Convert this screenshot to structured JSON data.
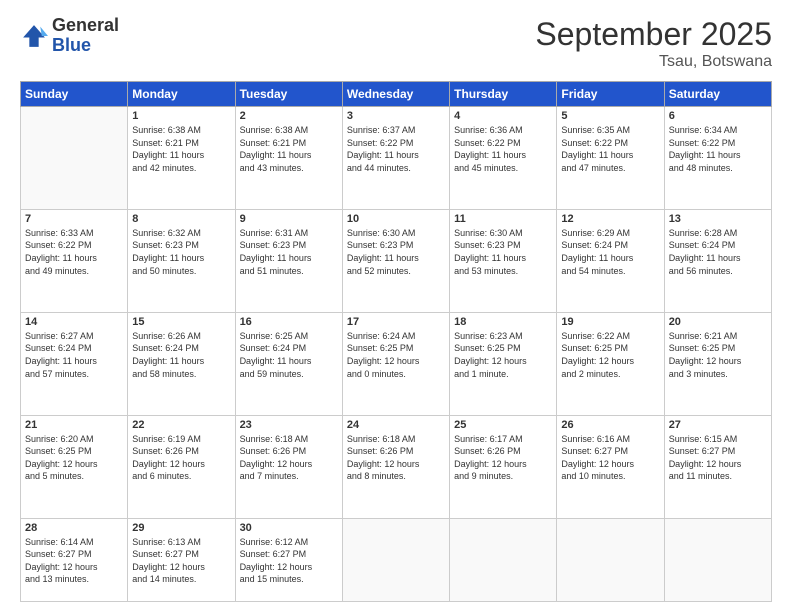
{
  "logo": {
    "general": "General",
    "blue": "Blue"
  },
  "header": {
    "month": "September 2025",
    "location": "Tsau, Botswana"
  },
  "weekdays": [
    "Sunday",
    "Monday",
    "Tuesday",
    "Wednesday",
    "Thursday",
    "Friday",
    "Saturday"
  ],
  "weeks": [
    [
      {
        "day": "",
        "info": ""
      },
      {
        "day": "1",
        "info": "Sunrise: 6:38 AM\nSunset: 6:21 PM\nDaylight: 11 hours\nand 42 minutes."
      },
      {
        "day": "2",
        "info": "Sunrise: 6:38 AM\nSunset: 6:21 PM\nDaylight: 11 hours\nand 43 minutes."
      },
      {
        "day": "3",
        "info": "Sunrise: 6:37 AM\nSunset: 6:22 PM\nDaylight: 11 hours\nand 44 minutes."
      },
      {
        "day": "4",
        "info": "Sunrise: 6:36 AM\nSunset: 6:22 PM\nDaylight: 11 hours\nand 45 minutes."
      },
      {
        "day": "5",
        "info": "Sunrise: 6:35 AM\nSunset: 6:22 PM\nDaylight: 11 hours\nand 47 minutes."
      },
      {
        "day": "6",
        "info": "Sunrise: 6:34 AM\nSunset: 6:22 PM\nDaylight: 11 hours\nand 48 minutes."
      }
    ],
    [
      {
        "day": "7",
        "info": "Sunrise: 6:33 AM\nSunset: 6:22 PM\nDaylight: 11 hours\nand 49 minutes."
      },
      {
        "day": "8",
        "info": "Sunrise: 6:32 AM\nSunset: 6:23 PM\nDaylight: 11 hours\nand 50 minutes."
      },
      {
        "day": "9",
        "info": "Sunrise: 6:31 AM\nSunset: 6:23 PM\nDaylight: 11 hours\nand 51 minutes."
      },
      {
        "day": "10",
        "info": "Sunrise: 6:30 AM\nSunset: 6:23 PM\nDaylight: 11 hours\nand 52 minutes."
      },
      {
        "day": "11",
        "info": "Sunrise: 6:30 AM\nSunset: 6:23 PM\nDaylight: 11 hours\nand 53 minutes."
      },
      {
        "day": "12",
        "info": "Sunrise: 6:29 AM\nSunset: 6:24 PM\nDaylight: 11 hours\nand 54 minutes."
      },
      {
        "day": "13",
        "info": "Sunrise: 6:28 AM\nSunset: 6:24 PM\nDaylight: 11 hours\nand 56 minutes."
      }
    ],
    [
      {
        "day": "14",
        "info": "Sunrise: 6:27 AM\nSunset: 6:24 PM\nDaylight: 11 hours\nand 57 minutes."
      },
      {
        "day": "15",
        "info": "Sunrise: 6:26 AM\nSunset: 6:24 PM\nDaylight: 11 hours\nand 58 minutes."
      },
      {
        "day": "16",
        "info": "Sunrise: 6:25 AM\nSunset: 6:24 PM\nDaylight: 11 hours\nand 59 minutes."
      },
      {
        "day": "17",
        "info": "Sunrise: 6:24 AM\nSunset: 6:25 PM\nDaylight: 12 hours\nand 0 minutes."
      },
      {
        "day": "18",
        "info": "Sunrise: 6:23 AM\nSunset: 6:25 PM\nDaylight: 12 hours\nand 1 minute."
      },
      {
        "day": "19",
        "info": "Sunrise: 6:22 AM\nSunset: 6:25 PM\nDaylight: 12 hours\nand 2 minutes."
      },
      {
        "day": "20",
        "info": "Sunrise: 6:21 AM\nSunset: 6:25 PM\nDaylight: 12 hours\nand 3 minutes."
      }
    ],
    [
      {
        "day": "21",
        "info": "Sunrise: 6:20 AM\nSunset: 6:25 PM\nDaylight: 12 hours\nand 5 minutes."
      },
      {
        "day": "22",
        "info": "Sunrise: 6:19 AM\nSunset: 6:26 PM\nDaylight: 12 hours\nand 6 minutes."
      },
      {
        "day": "23",
        "info": "Sunrise: 6:18 AM\nSunset: 6:26 PM\nDaylight: 12 hours\nand 7 minutes."
      },
      {
        "day": "24",
        "info": "Sunrise: 6:18 AM\nSunset: 6:26 PM\nDaylight: 12 hours\nand 8 minutes."
      },
      {
        "day": "25",
        "info": "Sunrise: 6:17 AM\nSunset: 6:26 PM\nDaylight: 12 hours\nand 9 minutes."
      },
      {
        "day": "26",
        "info": "Sunrise: 6:16 AM\nSunset: 6:27 PM\nDaylight: 12 hours\nand 10 minutes."
      },
      {
        "day": "27",
        "info": "Sunrise: 6:15 AM\nSunset: 6:27 PM\nDaylight: 12 hours\nand 11 minutes."
      }
    ],
    [
      {
        "day": "28",
        "info": "Sunrise: 6:14 AM\nSunset: 6:27 PM\nDaylight: 12 hours\nand 13 minutes."
      },
      {
        "day": "29",
        "info": "Sunrise: 6:13 AM\nSunset: 6:27 PM\nDaylight: 12 hours\nand 14 minutes."
      },
      {
        "day": "30",
        "info": "Sunrise: 6:12 AM\nSunset: 6:27 PM\nDaylight: 12 hours\nand 15 minutes."
      },
      {
        "day": "",
        "info": ""
      },
      {
        "day": "",
        "info": ""
      },
      {
        "day": "",
        "info": ""
      },
      {
        "day": "",
        "info": ""
      }
    ]
  ]
}
